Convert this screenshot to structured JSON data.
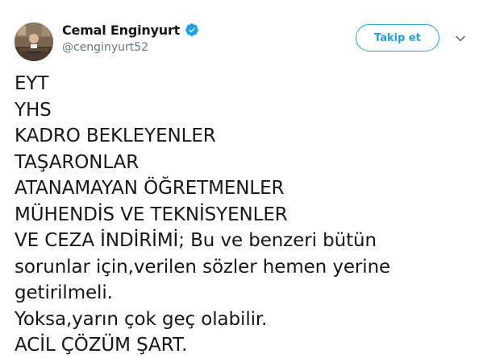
{
  "author": {
    "display_name": "Cemal Enginyurt",
    "handle": "@cenginyurt52",
    "verified": true,
    "verified_icon": "verified-badge-icon",
    "avatar_icon": "profile-photo"
  },
  "actions": {
    "follow_label": "Takip et",
    "menu_icon": "chevron-down-icon"
  },
  "tweet": {
    "lines": [
      "EYT",
      "YHS",
      "KADRO BEKLEYENLER",
      "TAŞARONLAR",
      "ATANAMAYAN ÖĞRETMENLER",
      "MÜHENDİS VE TEKNİSYENLER",
      "VE CEZA İNDİRİMİ; Bu ve benzeri bütün",
      "sorunlar için,verilen sözler hemen yerine",
      "getirilmeli.",
      "Yoksa,yarın çok geç olabilir.",
      "ACİL ÇÖZÜM ŞART."
    ]
  },
  "colors": {
    "accent": "#1da1f2",
    "text": "#14171a",
    "muted": "#657786"
  }
}
